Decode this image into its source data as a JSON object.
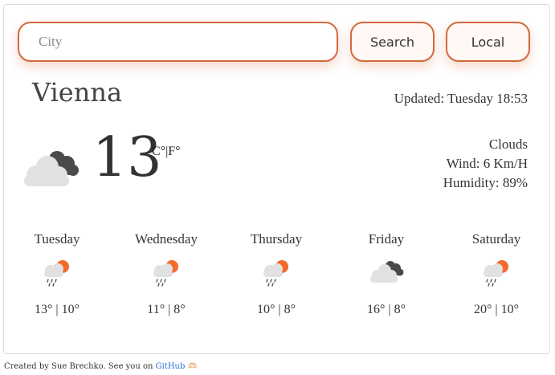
{
  "search": {
    "placeholder": "City",
    "search_label": "Search",
    "local_label": "Local"
  },
  "current": {
    "city": "Vienna",
    "updated": "Updated: Tuesday 18:53",
    "temperature": "13",
    "unit_c": "C°",
    "unit_sep": "|",
    "unit_f": "F°",
    "description": "Clouds",
    "wind": "Wind: 6 Km/H",
    "humidity": "Humidity: 89%",
    "icon": "broken-clouds-icon"
  },
  "forecast": [
    {
      "day": "Tuesday",
      "temps": "13° | 10°",
      "icon": "rain-sun-icon"
    },
    {
      "day": "Wednesday",
      "temps": "11° | 8°",
      "icon": "rain-sun-icon"
    },
    {
      "day": "Thursday",
      "temps": "10° | 8°",
      "icon": "rain-sun-icon"
    },
    {
      "day": "Friday",
      "temps": "16° | 8°",
      "icon": "broken-clouds-icon"
    },
    {
      "day": "Saturday",
      "temps": "20° | 10°",
      "icon": "rain-sun-icon"
    }
  ],
  "footer": {
    "text": "Created by Sue Brechko. See you on",
    "link": "GitHub",
    "emoji": "🫶🏻"
  },
  "colors": {
    "accent": "#d2693f",
    "sun": "#f26b2c",
    "cloud_light": "#e1e1e1",
    "cloud_dark": "#4a4a4a",
    "link": "#2a6fd6"
  }
}
